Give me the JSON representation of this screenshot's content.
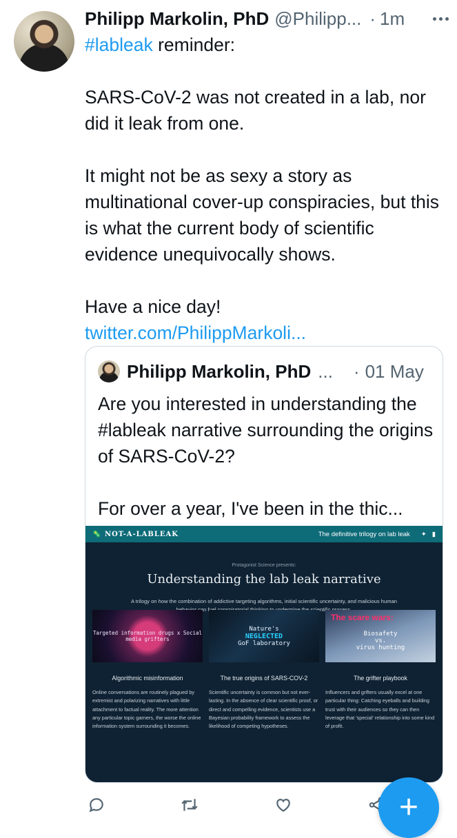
{
  "tweet": {
    "author_name": "Philipp Markolin, PhD",
    "handle": "@Philipp...",
    "separator": "·",
    "time": "1m",
    "hashtag": "#lableak",
    "line1_rest": " reminder:",
    "para1": "SARS-CoV-2 was not created in a lab, nor did it leak from one.",
    "para2": "It might not be as sexy a story as multinational cover-up conspiracies, but this is what the current body of scientific evidence unequivocally shows.",
    "para3": "Have a nice day!",
    "link": "twitter.com/PhilippMarkoli..."
  },
  "quoted": {
    "author_name": "Philipp Markolin, PhD",
    "ellipsis": "...",
    "separator": "·",
    "time": "01 May",
    "para1": "Are you interested in understanding the #lableak narrative surrounding the origins of SARS-CoV-2?",
    "para2": "For over a year, I've been in the thic..."
  },
  "preview": {
    "logo": "NOT-A-LABLEAK",
    "tagline": "The definitive trilogy on lab leak",
    "presents": "Protagonist Science presents:",
    "title": "Understanding the lab leak narrative",
    "subtitle": "A trilogy on how the combination of addictive targeting algorithms, initial scientific uncertainty, and malicious human behavior can fuel conspiratorial thinking to undermine the scientific process.",
    "cards": [
      {
        "image_text": "Targeted information drugs x Social media grifters",
        "title": "Algorithmic misinformation",
        "text": "Online conversations are routinely plagued by extremist and polarizing narratives with little attachment to factual reality. The more attention any particular topic garners, the worse the online information system surrounding it becomes."
      },
      {
        "image_line1": "Nature's",
        "image_line2": "NEGLECTED",
        "image_line3": "GoF laboratory",
        "title": "The true origins of SARS-COV-2",
        "text": "Scientific uncertainty is common but not ever-lasting. In the absence of clear scientific proof, or direct and compelling evidence, scientists use a Bayesian probability framework to assess the likelihood of competing hypotheses."
      },
      {
        "image_title": "The scare wars:",
        "image_line1": "Biosafety",
        "image_line2": "vs.",
        "image_line3": "virus hunting",
        "title": "The grifter playbook",
        "text": "Influencers and grifters usually excel at one particular thing: Catching eyeballs and building trust with their audiences so they can then leverage that 'special' relationship into some kind of profit."
      }
    ]
  },
  "actions": {
    "icons": [
      "reply-icon",
      "retweet-icon",
      "like-icon",
      "share-icon"
    ],
    "fab_label": "+"
  },
  "colors": {
    "accent": "#1d9bf0",
    "text": "#0f1419",
    "muted": "#536471",
    "preview_bg": "#0f2233",
    "preview_bar": "#0e6b78"
  }
}
